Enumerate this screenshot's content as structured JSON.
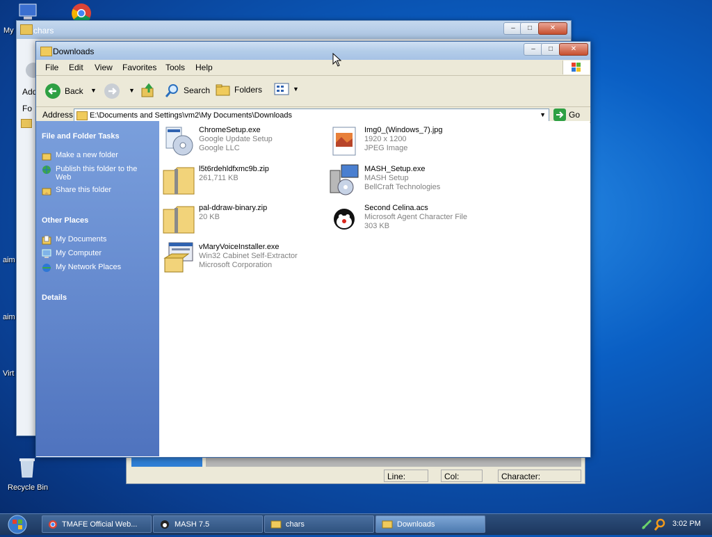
{
  "desktop": {
    "icons": [
      {
        "label": "My",
        "icon": "computer-icon"
      },
      {
        "label": "aim",
        "icon": "aim-icon"
      },
      {
        "label": "aim",
        "icon": "aim-icon"
      },
      {
        "label": "Virt",
        "icon": "virtual-icon"
      },
      {
        "label": "Recycle Bin",
        "icon": "recycle-bin-icon"
      }
    ]
  },
  "bg_window": {
    "title": "chars",
    "menu_partial": "Fo",
    "address_partial": "Add"
  },
  "window": {
    "title": "Downloads",
    "menu": [
      "File",
      "Edit",
      "View",
      "Favorites",
      "Tools",
      "Help"
    ],
    "toolbar": {
      "back": "Back",
      "search": "Search",
      "folders": "Folders"
    },
    "address": {
      "label": "Address",
      "value": "E:\\Documents and Settings\\vm2\\My Documents\\Downloads",
      "go": "Go"
    },
    "tasks": {
      "file_folder_header": "File and Folder Tasks",
      "file_folder_items": [
        "Make a new folder",
        "Publish this folder to the Web",
        "Share this folder"
      ],
      "other_places_header": "Other Places",
      "other_places_items": [
        "My Documents",
        "My Computer",
        "My Network Places"
      ],
      "details_header": "Details"
    },
    "files": [
      {
        "name": "ChromeSetup.exe",
        "line2": "Google Update Setup",
        "line3": "Google LLC",
        "icon": "setup-cd-icon"
      },
      {
        "name": "Img0_(Windows_7).jpg",
        "line2": "1920 x 1200",
        "line3": "JPEG Image",
        "icon": "jpeg-image-icon"
      },
      {
        "name": "l5t6rdehldfxmc9b.zip",
        "line2": "261,711 KB",
        "line3": "",
        "icon": "zip-folder-icon"
      },
      {
        "name": "MASH_Setup.exe",
        "line2": "MASH Setup",
        "line3": "BellCraft Technologies",
        "icon": "installer-computer-icon"
      },
      {
        "name": "pal-ddraw-binary.zip",
        "line2": "20 KB",
        "line3": "",
        "icon": "zip-folder-icon"
      },
      {
        "name": "Second Celina.acs",
        "line2": "Microsoft Agent Character File",
        "line3": "303 KB",
        "icon": "agent-character-icon"
      },
      {
        "name": "vMaryVoiceInstaller.exe",
        "line2": "Win32 Cabinet Self-Extractor",
        "line3": "Microsoft Corporation",
        "icon": "cabinet-installer-icon"
      }
    ]
  },
  "editor_status": {
    "line_label": "Line:",
    "col_label": "Col:",
    "char_label": "Character:"
  },
  "taskbar": {
    "buttons": [
      {
        "label": "TMAFE Official Web...",
        "icon": "chrome-icon"
      },
      {
        "label": "MASH 7.5",
        "icon": "mash-icon"
      },
      {
        "label": "chars",
        "icon": "folder-icon"
      },
      {
        "label": "Downloads",
        "icon": "folder-icon"
      }
    ],
    "clock": "3:02 PM"
  },
  "colors": {
    "task_pane_top": "#7a9fdc",
    "task_pane_bottom": "#4f73be",
    "accent_green": "#2ea043"
  }
}
